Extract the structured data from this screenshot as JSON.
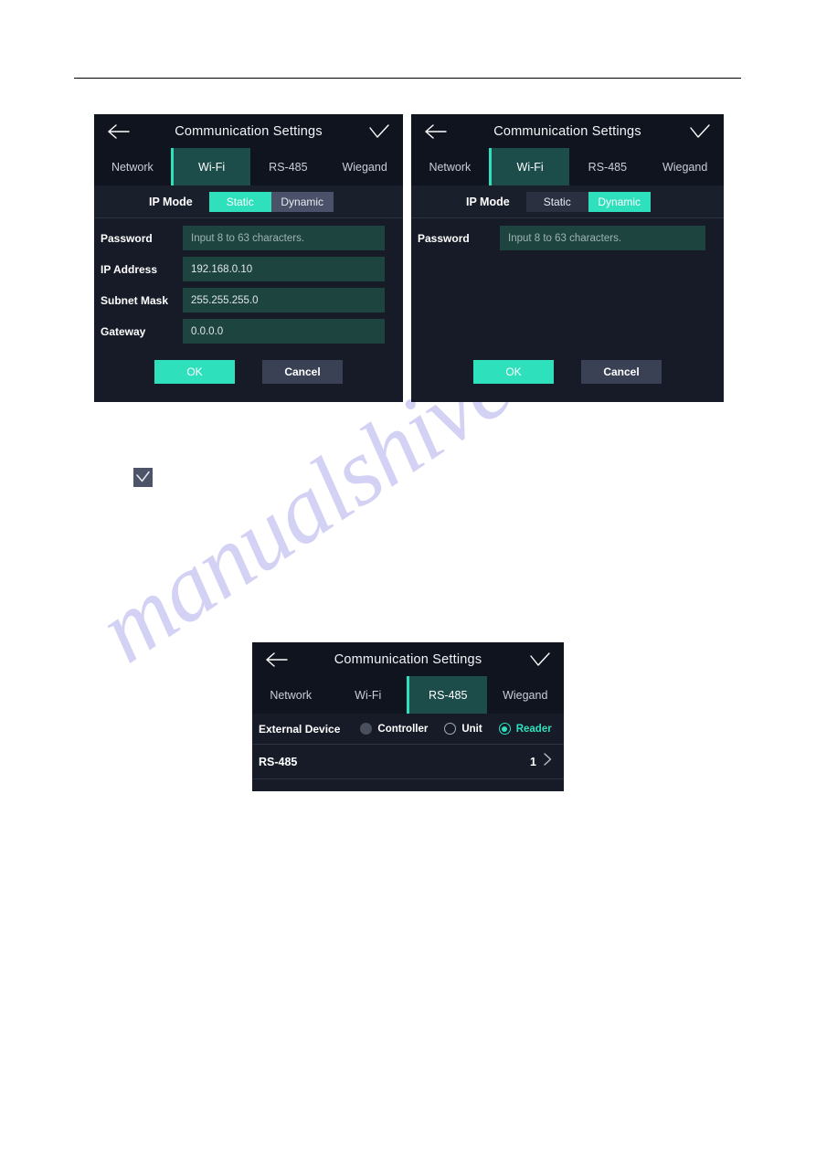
{
  "page": {
    "watermark": "manualshive.com"
  },
  "common": {
    "title": "Communication Settings",
    "back_icon": "back-arrow-icon",
    "confirm_icon": "checkmark-icon",
    "tabs": [
      {
        "label": "Network"
      },
      {
        "label": "Wi-Fi"
      },
      {
        "label": "RS-485"
      },
      {
        "label": "Wiegand"
      }
    ],
    "ok_label": "OK",
    "cancel_label": "Cancel",
    "accent_color": "#2fe0bd",
    "active_tab_bg": "#1c4d4b",
    "screen_bg": "#161b27"
  },
  "panel_static": {
    "active_tab_index": 1,
    "ip_mode": {
      "label": "IP Mode",
      "options": [
        "Static",
        "Dynamic"
      ],
      "selected": "Static"
    },
    "fields": [
      {
        "label": "Password",
        "value": "Input 8 to 63 characters.",
        "is_placeholder": true
      },
      {
        "label": "IP Address",
        "value": "192.168.0.10",
        "is_placeholder": false
      },
      {
        "label": "Subnet Mask",
        "value": "255.255.255.0",
        "is_placeholder": false
      },
      {
        "label": "Gateway",
        "value": "0.0.0.0",
        "is_placeholder": false
      }
    ]
  },
  "panel_dynamic": {
    "active_tab_index": 1,
    "ip_mode": {
      "label": "IP Mode",
      "options": [
        "Static",
        "Dynamic"
      ],
      "selected": "Dynamic"
    },
    "fields": [
      {
        "label": "Password",
        "value": "Input 8 to 63 characters.",
        "is_placeholder": true
      }
    ]
  },
  "panel_rs485": {
    "active_tab_index": 2,
    "external_device": {
      "label": "External Device",
      "options": [
        {
          "label": "Controller",
          "state": "unselected-filled"
        },
        {
          "label": "Unit",
          "state": "unselected-outline"
        },
        {
          "label": "Reader",
          "state": "selected"
        }
      ],
      "selected": "Reader"
    },
    "list": [
      {
        "label": "RS-485",
        "value": "1",
        "chevron": "chevron-right-icon"
      }
    ]
  },
  "note_icon": {
    "name": "checkbox-checked-icon"
  }
}
